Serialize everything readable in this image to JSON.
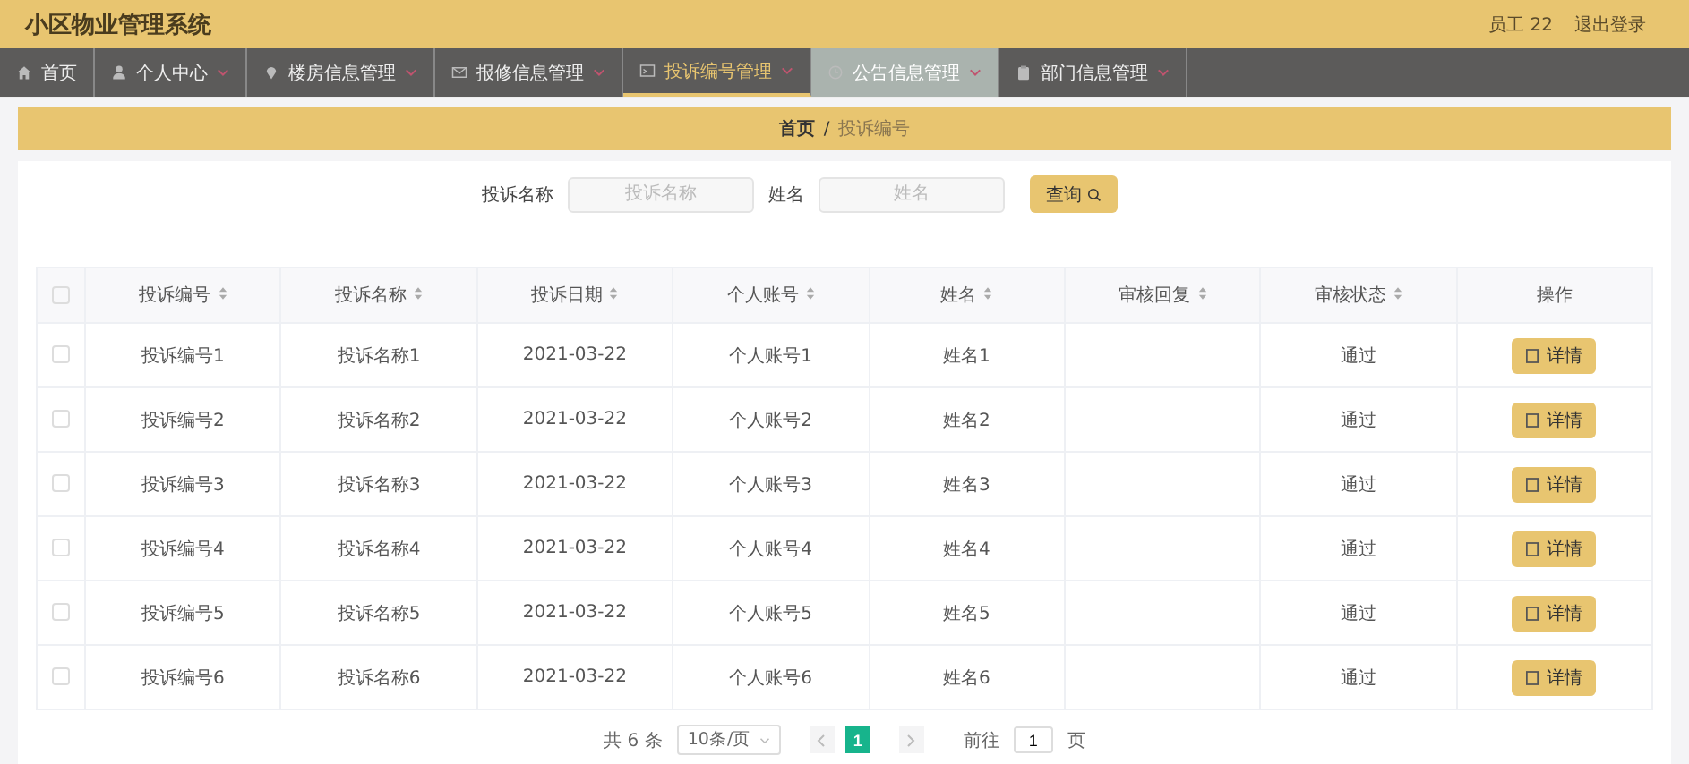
{
  "header": {
    "title": "小区物业管理系统",
    "user": "员工 22",
    "logout": "退出登录"
  },
  "nav": [
    {
      "label": "首页",
      "selected": false,
      "hovered": false,
      "dropdown": false
    },
    {
      "label": "个人中心",
      "selected": false,
      "hovered": false,
      "dropdown": true
    },
    {
      "label": "楼房信息管理",
      "selected": false,
      "hovered": false,
      "dropdown": true
    },
    {
      "label": "报修信息管理",
      "selected": false,
      "hovered": false,
      "dropdown": true
    },
    {
      "label": "投诉编号管理",
      "selected": true,
      "hovered": false,
      "dropdown": true
    },
    {
      "label": "公告信息管理",
      "selected": false,
      "hovered": true,
      "dropdown": true
    },
    {
      "label": "部门信息管理",
      "selected": false,
      "hovered": false,
      "dropdown": true
    }
  ],
  "breadcrumb": {
    "separator": "/",
    "items": [
      "首页",
      "投诉编号"
    ]
  },
  "search": {
    "fields": [
      {
        "label": "投诉名称",
        "placeholder": "投诉名称"
      },
      {
        "label": "姓名",
        "placeholder": "姓名"
      }
    ],
    "button": "查询"
  },
  "table": {
    "all_checked": false,
    "columns": [
      {
        "label": "投诉编号",
        "sortable": true
      },
      {
        "label": "投诉名称",
        "sortable": true
      },
      {
        "label": "投诉日期",
        "sortable": true
      },
      {
        "label": "个人账号",
        "sortable": true
      },
      {
        "label": "姓名",
        "sortable": true
      },
      {
        "label": "审核回复",
        "sortable": true
      },
      {
        "label": "审核状态",
        "sortable": true
      },
      {
        "label": "操作",
        "sortable": false
      }
    ],
    "rows": [
      {
        "checked": false,
        "cells": [
          "投诉编号1",
          "投诉名称1",
          "2021-03-22",
          "个人账号1",
          "姓名1",
          "",
          "通过"
        ],
        "action": "详情"
      },
      {
        "checked": false,
        "cells": [
          "投诉编号2",
          "投诉名称2",
          "2021-03-22",
          "个人账号2",
          "姓名2",
          "",
          "通过"
        ],
        "action": "详情"
      },
      {
        "checked": false,
        "cells": [
          "投诉编号3",
          "投诉名称3",
          "2021-03-22",
          "个人账号3",
          "姓名3",
          "",
          "通过"
        ],
        "action": "详情"
      },
      {
        "checked": false,
        "cells": [
          "投诉编号4",
          "投诉名称4",
          "2021-03-22",
          "个人账号4",
          "姓名4",
          "",
          "通过"
        ],
        "action": "详情"
      },
      {
        "checked": false,
        "cells": [
          "投诉编号5",
          "投诉名称5",
          "2021-03-22",
          "个人账号5",
          "姓名5",
          "",
          "通过"
        ],
        "action": "详情"
      },
      {
        "checked": false,
        "cells": [
          "投诉编号6",
          "投诉名称6",
          "2021-03-22",
          "个人账号6",
          "姓名6",
          "",
          "通过"
        ],
        "action": "详情"
      }
    ]
  },
  "pagination": {
    "total": "共 6 条",
    "page_size": "10条/页",
    "pages": [
      {
        "label": "1",
        "selected": true
      }
    ],
    "goto_label": "前往",
    "goto_value": "1",
    "goto_suffix": "页"
  }
}
